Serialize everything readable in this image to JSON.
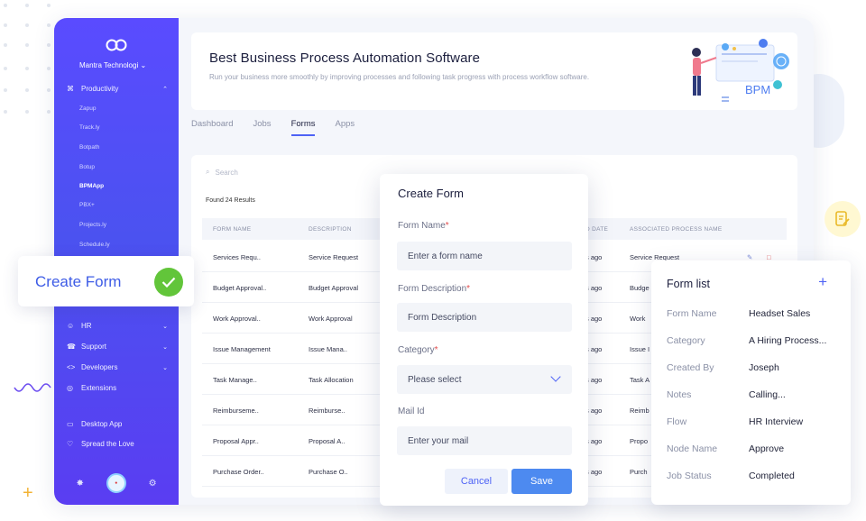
{
  "colors": {
    "accent": "#4e63f5",
    "sidebar": "#5a4bff",
    "save": "#4d8af0",
    "success": "#62c53a",
    "required": "#e24c4c"
  },
  "sidebar": {
    "org": "Mantra Technologi",
    "sections": [
      {
        "icon": "command-icon",
        "label": "Productivity",
        "expanded": true
      },
      {
        "icon": "users-icon",
        "label": "HR"
      },
      {
        "icon": "headset-icon",
        "label": "Support"
      },
      {
        "icon": "code-icon",
        "label": "Developers"
      },
      {
        "icon": "globe-icon",
        "label": "Extensions"
      },
      {
        "icon": "monitor-icon",
        "label": "Desktop App"
      },
      {
        "icon": "heart-icon",
        "label": "Spread the Love"
      }
    ],
    "apps": [
      "Zapup",
      "Track.ly",
      "Botpath",
      "Botup",
      "BPMApp",
      "PBX+",
      "Projects.ly",
      "Schedule.ly"
    ],
    "active_app": "BPMApp"
  },
  "hero": {
    "title": "Best Business Process Automation Software",
    "subtitle": "Run your business more smoothly by improving processes and following task progress with process workflow software.",
    "illustration_label": "BPM"
  },
  "tabs": [
    {
      "label": "Dashboard",
      "active": false
    },
    {
      "label": "Jobs",
      "active": false
    },
    {
      "label": "Forms",
      "active": true
    },
    {
      "label": "Apps",
      "active": false
    }
  ],
  "table": {
    "search_placeholder": "Search",
    "found": "Found 24 Results",
    "columns": [
      "FORM NAME",
      "DESCRIPTION",
      "D DATE",
      "ASSOCIATED PROCESS NAME"
    ],
    "rows": [
      {
        "name": "Services Requ..",
        "desc": "Service Request",
        "date": "s ago",
        "process": "Service Request"
      },
      {
        "name": "Budget Approval..",
        "desc": "Budget Approval",
        "date": "s ago",
        "process": "Budge"
      },
      {
        "name": "Work Approval..",
        "desc": "Work Approval",
        "date": "s ago",
        "process": "Work"
      },
      {
        "name": "Issue Management",
        "desc": "Issue Mana..",
        "date": "s ago",
        "process": "Issue I"
      },
      {
        "name": "Task Manage..",
        "desc": "Task Allocation",
        "date": "s ago",
        "process": "Task A"
      },
      {
        "name": "Reimburseme..",
        "desc": "Reimburse..",
        "date": "s ago",
        "process": "Reimb"
      },
      {
        "name": "Proposal Appr..",
        "desc": "Proposal A..",
        "date": "s ago",
        "process": "Propo"
      },
      {
        "name": "Purchase Order..",
        "desc": "Purchase O..",
        "date": "s ago",
        "process": "Purch"
      }
    ]
  },
  "modal": {
    "title": "Create Form",
    "required_mark": "*",
    "form_name": {
      "label": "Form Name",
      "placeholder": "Enter a form name"
    },
    "form_description": {
      "label": "Form Description",
      "placeholder": "Form Description"
    },
    "category": {
      "label": "Category",
      "value": "Please select"
    },
    "mail": {
      "label": "Mail Id",
      "placeholder": "Enter your mail"
    },
    "cancel_label": "Cancel",
    "save_label": "Save"
  },
  "form_list": {
    "title": "Form list",
    "add_symbol": "+",
    "fields": [
      {
        "key": "Form Name",
        "value": "Headset Sales"
      },
      {
        "key": "Category",
        "value": "A Hiring Process..."
      },
      {
        "key": "Created By",
        "value": "Joseph"
      },
      {
        "key": "Notes",
        "value": "Calling..."
      },
      {
        "key": "Flow",
        "value": "HR Interview"
      },
      {
        "key": "Node Name",
        "value": "Approve"
      },
      {
        "key": "Job Status",
        "value": "Completed"
      }
    ]
  },
  "callout": {
    "label": "Create Form"
  }
}
